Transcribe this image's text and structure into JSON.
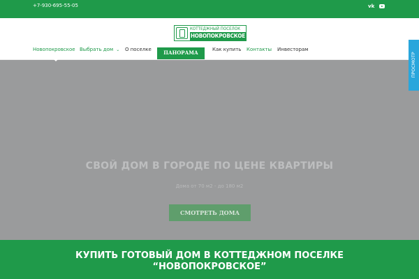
{
  "topbar": {
    "phone": "+7-930-695-55-05",
    "social": {
      "vk_label": "vk",
      "vk_icon": "vk-icon",
      "youtube_icon": "youtube-icon"
    }
  },
  "logo": {
    "top_text": "КОТТЕДЖНЫЙ ПОСЕЛОК",
    "main_text": "НОВОПОКРОВСКОЕ",
    "emblem_icon": "monogram-emblem-icon"
  },
  "nav": {
    "items": [
      "Новопокровское",
      "Выбрать дом",
      "О поселке",
      "ПАНОРАМА",
      "Как купить",
      "Контакты",
      "Инвесторам"
    ],
    "dropdown_icon": "chevron-down-icon",
    "active_index": 0
  },
  "hero": {
    "title": "СВОЙ ДОМ В ГОРОДЕ ПО ЦЕНЕ КВАРТИРЫ",
    "subtitle": "Дома от 70 м2 - до 180 м2",
    "button": "СМОТРЕТЬ ДОМА"
  },
  "side_tab": {
    "label": "ПРОСМОТР"
  },
  "bottom": {
    "line1": "КУПИТЬ ГОТОВЫЙ ДОМ В КОТТЕДЖНОМ ПОСЕЛКЕ",
    "line2": "“НОВОПОКРОВСКОЕ”"
  },
  "colors": {
    "brand_green": "#1f9a4a",
    "hero_gray": "#9a9b9c",
    "button_green": "#5f9e6c",
    "side_tab_blue": "#29a6dc"
  }
}
